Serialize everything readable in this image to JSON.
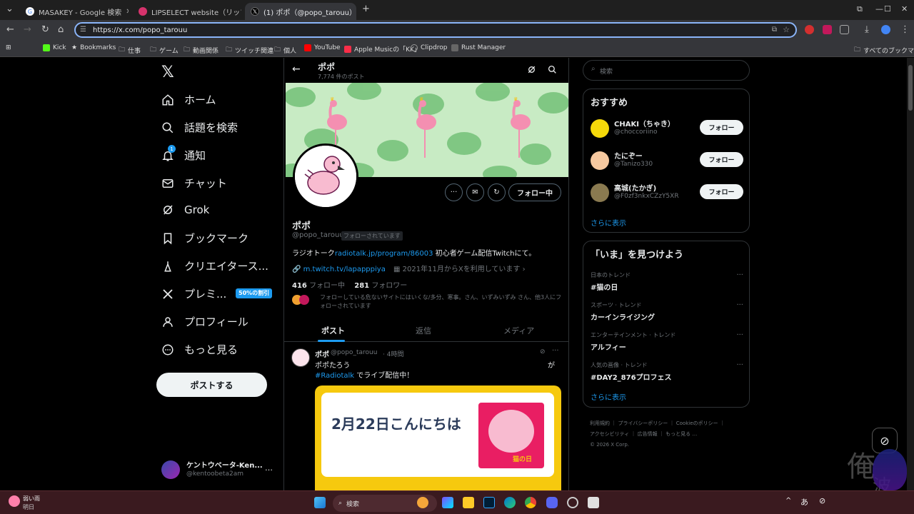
{
  "tabs": [
    {
      "title": "MASAKEY - Google 検索",
      "active": false
    },
    {
      "title": "LIPSELECT website（リップセレク",
      "active": false
    },
    {
      "title": "(1) ポポ（@popo_tarouu）さん",
      "active": true
    }
  ],
  "new_tab_label": "+",
  "address": {
    "url": "https://x.com/popo_tarouu"
  },
  "bookmarks": [
    {
      "label": "Kick",
      "color": "#53fc18"
    },
    {
      "label": "Bookmarks",
      "color": "#cccccc"
    },
    {
      "label": "仕事",
      "color": "#cccccc"
    },
    {
      "label": "ゲーム",
      "color": "#cccccc"
    },
    {
      "label": "動画関係",
      "color": "#cccccc"
    },
    {
      "label": "ツイッチ関連",
      "color": "#cccccc"
    },
    {
      "label": "個人",
      "color": "#cccccc"
    },
    {
      "label": "YouTube",
      "color": "#ff0000"
    },
    {
      "label": "Apple Musicの「KK」",
      "color": "#fa2d48"
    },
    {
      "label": "Clipdrop",
      "color": "#999999"
    },
    {
      "label": "Rust Manager",
      "color": "#888888"
    }
  ],
  "all_bookmarks": "すべてのブックマーク",
  "left_nav": {
    "items": [
      {
        "label": "ホーム",
        "icon": "home-icon"
      },
      {
        "label": "話題を検索",
        "icon": "search-icon"
      },
      {
        "label": "通知",
        "icon": "bell-icon"
      },
      {
        "label": "チャット",
        "icon": "mail-icon"
      },
      {
        "label": "Grok",
        "icon": "grok-icon"
      },
      {
        "label": "ブックマーク",
        "icon": "bookmark-icon"
      },
      {
        "label": "クリエイタース...",
        "icon": "creator-icon"
      },
      {
        "label": "プレミ...",
        "icon": "x-premium-icon"
      },
      {
        "label": "プロフィール",
        "icon": "person-icon"
      },
      {
        "label": "もっと見る",
        "icon": "more-circle-icon"
      }
    ],
    "notif_badge": "1",
    "premium_badge": "50%の割引",
    "post_button": "ポストする",
    "account": {
      "name": "ケントウベータ-Ken...",
      "handle": "@kentoobeta2am",
      "more": "…"
    }
  },
  "profile": {
    "header_name": "ポポ",
    "post_count": "7,774 件のポスト",
    "name": "ポポ",
    "handle": "@popo_tarouu",
    "follows_you": "フォローされています",
    "bio_prefix": "ラジオトーク",
    "bio_link": "radiotalk.jp/program/86003",
    "bio_suffix": " 初心者ゲーム配信Twitchにて。",
    "website": "m.twitch.tv/lapapppiya",
    "joined": "2021年11月からXを利用しています",
    "following_count": "416",
    "following_label": "フォロー中",
    "followers_count": "281",
    "followers_label": "フォロワー",
    "mutuals": "フォローしている危ないサイトにはいくな/多分、寒事。さん、いずみいずみ さん、他3人にフォローされています",
    "follow_button": "フォロー中",
    "tabs": [
      "ポスト",
      "返信",
      "メディア"
    ]
  },
  "post": {
    "name": "ポポ",
    "handle": "@popo_tarouu",
    "time": "· 4時間",
    "line1": "ポポたろう",
    "line1_right": "が",
    "hashtag": "#Radiotalk",
    "line2": " でライブ配信中！",
    "card_text": "2月22日こんにちは",
    "card_sticker": "猫の日",
    "more": "···"
  },
  "search": {
    "placeholder": "検索"
  },
  "recommend": {
    "title": "おすすめ",
    "users": [
      {
        "name": "CHAKI（ちゃき）",
        "handle": "@choccoriino",
        "button": "フォロー",
        "avatar_color": "#f5d90a"
      },
      {
        "name": "たにぞー",
        "handle": "@Tanizo330",
        "button": "フォロー",
        "avatar_color": "#f6c9a0"
      },
      {
        "name": "高城(たかぎ)",
        "handle": "@F0zf3nkxCZzY5XR",
        "button": "フォロー",
        "avatar_color": "#8a7a50"
      }
    ],
    "show_more": "さらに表示"
  },
  "trends": {
    "title": "「いま」を見つけよう",
    "items": [
      {
        "category": "日本のトレンド",
        "name": "#猫の日"
      },
      {
        "category": "スポーツ · トレンド",
        "name": "カーインライジング"
      },
      {
        "category": "エンターテインメント · トレンド",
        "name": "アルフィー"
      },
      {
        "category": "人気の画像 · トレンド",
        "name": "#DAY2_876プロフェス"
      }
    ],
    "more": "···",
    "show_more": "さらに表示"
  },
  "footer": {
    "line1": "利用規約 ｜ プライバシーポリシー ｜ Cookieのポリシー ｜",
    "line2": "アクセシビリティ ｜ 広告情報 ｜ もっと見る …",
    "line3": "© 2026 X Corp."
  },
  "taskbar": {
    "weather_label": "弱い雨",
    "weather_sub": "明日",
    "search_label": "検索",
    "ime": "あ",
    "watermark": "俺",
    "watermark2": "波"
  },
  "colors": {
    "accent": "#1d9bf0",
    "banner": "#c8ebc4",
    "taskbar": "#3a1a1f"
  }
}
